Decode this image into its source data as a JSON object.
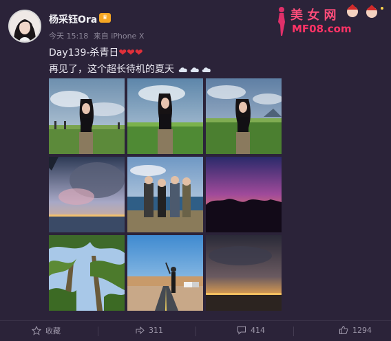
{
  "user": {
    "name": "杨采钰Ora",
    "badge": "♛"
  },
  "meta": {
    "time": "今天 15:18",
    "source": "来自 iPhone X"
  },
  "post": {
    "line1_text": "Day139-杀青日",
    "hearts": "❤❤❤",
    "line2_text": "再见了，这个超长待机的夏天"
  },
  "watermark": {
    "line1": "美  女  网",
    "line2": "MF08.com"
  },
  "actions": {
    "favorite": "收藏",
    "share": "311",
    "comment": "414",
    "like": "1294"
  },
  "colors": {
    "background": "#2b2339",
    "heart": "#e0303a",
    "watermark": "#ff3366"
  }
}
